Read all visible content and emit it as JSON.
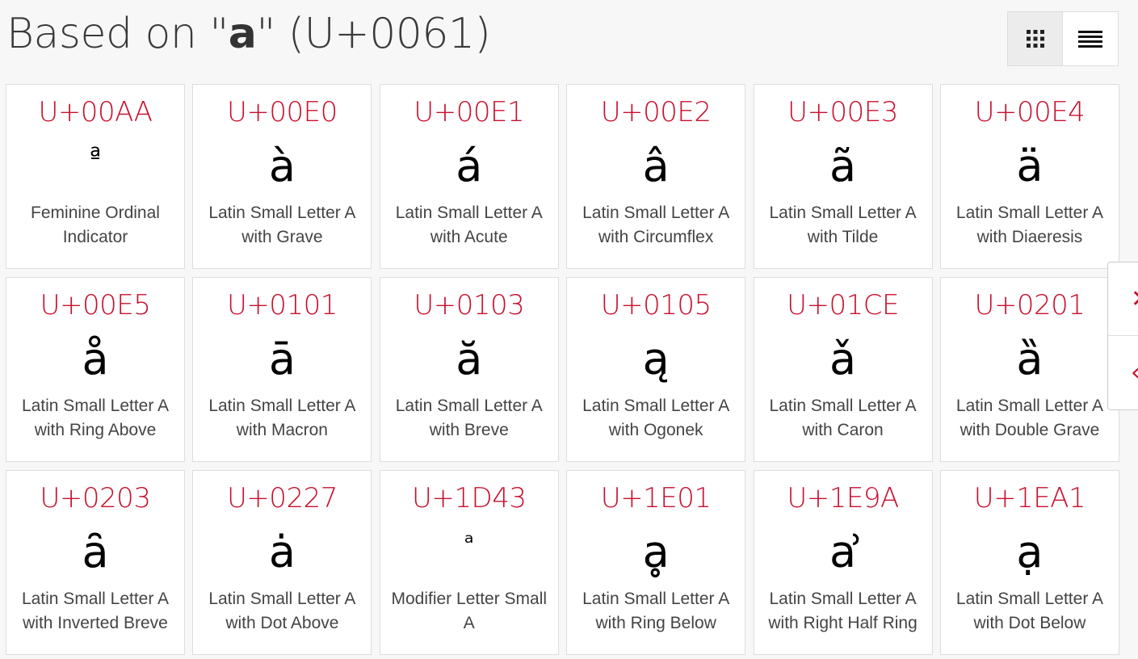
{
  "header": {
    "title_prefix": "Based on \"",
    "base_char": "a",
    "title_suffix": "\" (U+0061)"
  },
  "view_toggle": {
    "grid_icon": "grid-icon",
    "list_icon": "list-icon",
    "active": "grid"
  },
  "side_panel": {
    "top_icon": "close-icon",
    "bottom_icon": "share-icon",
    "accent": "#c8102e"
  },
  "colors": {
    "code": "#c8102e",
    "background": "#f7f7f7"
  },
  "cards": [
    {
      "code": "U+00AA",
      "glyph": "ª",
      "name": "Feminine Ordinal Indicator"
    },
    {
      "code": "U+00E0",
      "glyph": "à",
      "name": "Latin Small Letter A with Grave"
    },
    {
      "code": "U+00E1",
      "glyph": "á",
      "name": "Latin Small Letter A with Acute"
    },
    {
      "code": "U+00E2",
      "glyph": "â",
      "name": "Latin Small Letter A with Circumflex"
    },
    {
      "code": "U+00E3",
      "glyph": "ã",
      "name": "Latin Small Letter A with Tilde"
    },
    {
      "code": "U+00E4",
      "glyph": "ä",
      "name": "Latin Small Letter A with Diaeresis"
    },
    {
      "code": "U+00E5",
      "glyph": "å",
      "name": "Latin Small Letter A with Ring Above"
    },
    {
      "code": "U+0101",
      "glyph": "ā",
      "name": "Latin Small Letter A with Macron"
    },
    {
      "code": "U+0103",
      "glyph": "ă",
      "name": "Latin Small Letter A with Breve"
    },
    {
      "code": "U+0105",
      "glyph": "ą",
      "name": "Latin Small Letter A with Ogonek"
    },
    {
      "code": "U+01CE",
      "glyph": "ǎ",
      "name": "Latin Small Letter A with Caron"
    },
    {
      "code": "U+0201",
      "glyph": "ȁ",
      "name": "Latin Small Letter A with Double Grave"
    },
    {
      "code": "U+0203",
      "glyph": "ȃ",
      "name": "Latin Small Letter A with Inverted Breve"
    },
    {
      "code": "U+0227",
      "glyph": "ȧ",
      "name": "Latin Small Letter A with Dot Above"
    },
    {
      "code": "U+1D43",
      "glyph": "ᵃ",
      "name": "Modifier Letter Small A"
    },
    {
      "code": "U+1E01",
      "glyph": "ḁ",
      "name": "Latin Small Letter A with Ring Below"
    },
    {
      "code": "U+1E9A",
      "glyph": "ẚ",
      "name": "Latin Small Letter A with Right Half Ring"
    },
    {
      "code": "U+1EA1",
      "glyph": "ạ",
      "name": "Latin Small Letter A with Dot Below"
    }
  ]
}
